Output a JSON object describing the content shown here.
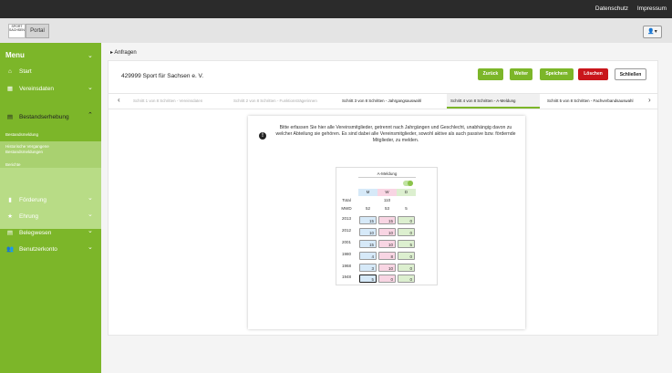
{
  "top": {
    "links": [
      "Datenschutz",
      "Impressum"
    ]
  },
  "header": {
    "logo_text": "SPORT SACHSEN",
    "portal_label": "Portal",
    "user_icon": "user-icon"
  },
  "sidebar": {
    "menu_label": "Menu",
    "items": [
      {
        "label": "Start",
        "icon": "home-icon"
      },
      {
        "label": "Vereinsdaten",
        "icon": "building-icon"
      },
      {
        "label": "Bestandserhebung",
        "icon": "chart-icon"
      },
      {
        "label": "Förderung",
        "icon": "document-icon"
      },
      {
        "label": "Ehrung",
        "icon": "star-icon"
      },
      {
        "label": "Belegwesen",
        "icon": "list-icon"
      },
      {
        "label": "Benutzerkonto",
        "icon": "users-icon"
      }
    ],
    "subitems": [
      "Bestandsmeldung",
      "Historische Vergangene Bestandsmeldungen",
      "Berichte"
    ]
  },
  "breadcrumb": "Anfragen",
  "club_name": "429999 Sport für Sachsen e. V.",
  "buttons": {
    "zurueck": "Zurück",
    "weiter": "Weiter",
    "speichern": "Speichern",
    "loeschen": "Löschen",
    "schliessen": "Schließen"
  },
  "colors": {
    "green": "#7cb629",
    "red": "#c9161b"
  },
  "steps": [
    "Schritt 1 von 8 Schritten - Vereinsdaten",
    "Schritt 2 von 8 Schritten - Funktionsträgerinnen",
    "Schritt 3 von 8 Schritten - Jahrgangsauswahl",
    "Schritt 4 von 8 Schritten - A-Meldung",
    "Schritt 5 von 8 Schritten - Fachverbandsauswahl"
  ],
  "info": "Bitte erfassen Sie hier alle Vereinsmitglieder, getrennt nach Jahrgängen und Geschlecht, unabhängig davon zu welcher Abteilung sie gehören. Es sind dabei alle Vereinsmitglieder, sowohl aktive als auch passive bzw. fördernde Mitglieder, zu melden.",
  "table": {
    "title": "A-Meldung",
    "columns": [
      "M",
      "W",
      "D"
    ],
    "total_label": "Total",
    "total_value": "110",
    "mwd_label": "MWD",
    "mwd_values": [
      "52",
      "53",
      "5"
    ],
    "rows": [
      {
        "year": "2013",
        "m": "15",
        "w": "15",
        "d": "0"
      },
      {
        "year": "2012",
        "m": "10",
        "w": "10",
        "d": "0"
      },
      {
        "year": "2001",
        "m": "15",
        "w": "10",
        "d": "5"
      },
      {
        "year": "1980",
        "m": "4",
        "w": "8",
        "d": "0"
      },
      {
        "year": "1968",
        "m": "3",
        "w": "10",
        "d": "0"
      },
      {
        "year": "1948",
        "m": "5",
        "w": "0",
        "d": "0"
      }
    ]
  }
}
